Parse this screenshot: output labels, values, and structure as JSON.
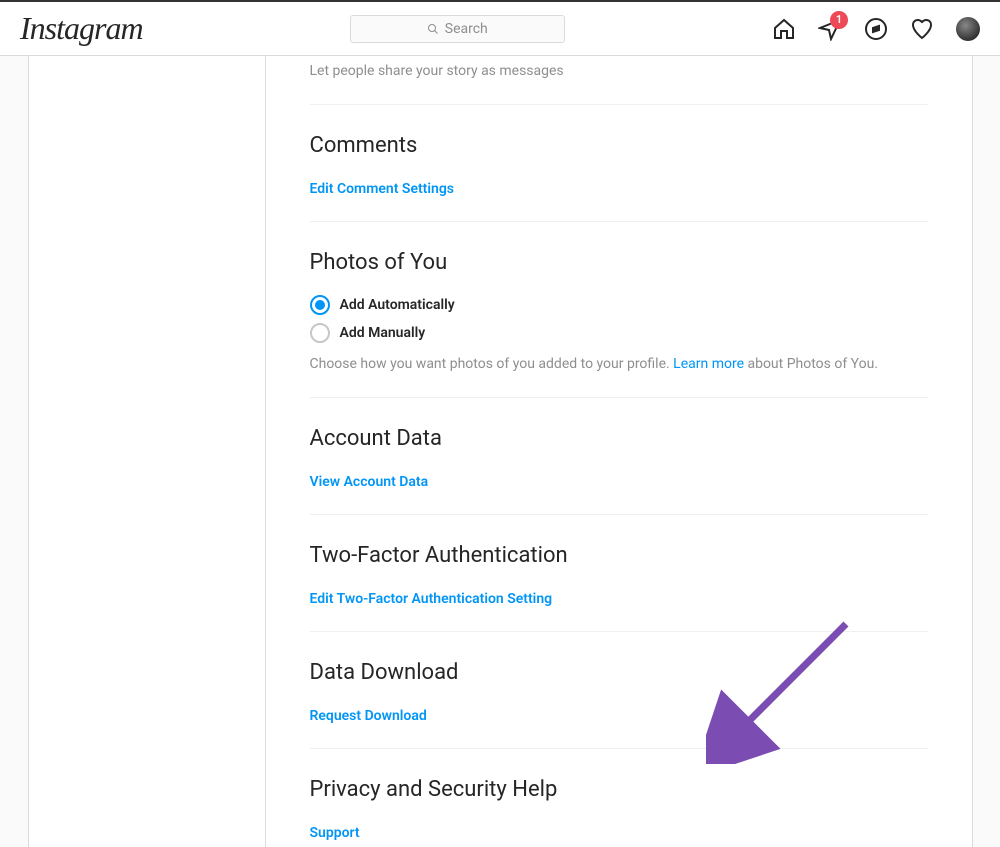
{
  "header": {
    "logo": "Instagram",
    "search_placeholder": "Search",
    "badge_count": "1"
  },
  "story_share": {
    "subtext": "Let people share your story as messages"
  },
  "comments": {
    "title": "Comments",
    "link": "Edit Comment Settings"
  },
  "photos_of_you": {
    "title": "Photos of You",
    "option_auto": "Add Automatically",
    "option_manual": "Add Manually",
    "help_prefix": "Choose how you want photos of you added to your profile. ",
    "learn_more": "Learn more",
    "help_suffix": " about Photos of You."
  },
  "account_data": {
    "title": "Account Data",
    "link": "View Account Data"
  },
  "two_factor": {
    "title": "Two-Factor Authentication",
    "link": "Edit Two-Factor Authentication Setting"
  },
  "data_download": {
    "title": "Data Download",
    "link": "Request Download"
  },
  "privacy_help": {
    "title": "Privacy and Security Help",
    "link": "Support"
  }
}
